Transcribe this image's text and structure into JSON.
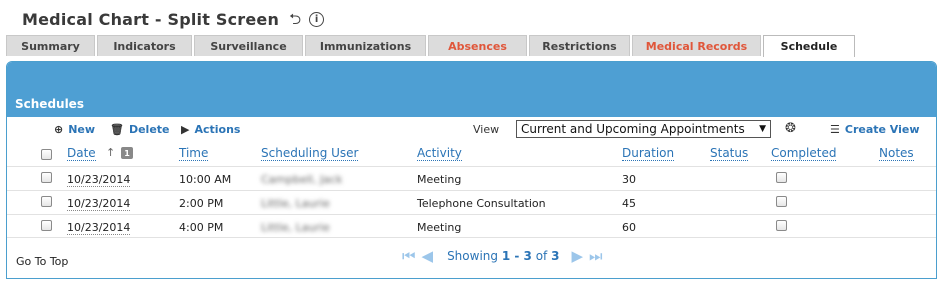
{
  "page": {
    "title": "Medical Chart - Split Screen",
    "title_icons": [
      "return-arrow-icon",
      "info-icon"
    ]
  },
  "tabs": [
    {
      "label": "Summary",
      "state": "normal"
    },
    {
      "label": "Indicators",
      "state": "normal"
    },
    {
      "label": "Surveillance",
      "state": "normal"
    },
    {
      "label": "Immunizations",
      "state": "normal"
    },
    {
      "label": "Absences",
      "state": "alert"
    },
    {
      "label": "Restrictions",
      "state": "normal"
    },
    {
      "label": "Medical Records",
      "state": "alert"
    },
    {
      "label": "Schedule",
      "state": "active"
    }
  ],
  "colors": {
    "header_blue": "#4e9fd3",
    "link_blue": "#2b74b6",
    "alert_red": "#e0563a"
  },
  "panel": {
    "title": "Schedules"
  },
  "toolbar": {
    "new_label": "New",
    "delete_label": "Delete",
    "actions_label": "Actions",
    "view_label": "View",
    "view_selected": "Current and Upcoming Appointments",
    "create_view_label": "Create View"
  },
  "columns": {
    "date": "Date",
    "sort_badge": "1",
    "time": "Time",
    "scheduling_user": "Scheduling User",
    "activity": "Activity",
    "duration": "Duration",
    "status": "Status",
    "completed": "Completed",
    "notes": "Notes"
  },
  "rows": [
    {
      "date": "10/23/2014",
      "time": "10:00 AM",
      "user": "Campbell, Jack",
      "activity": "Meeting",
      "duration": "30",
      "status": "",
      "completed": false,
      "notes": ""
    },
    {
      "date": "10/23/2014",
      "time": "2:00 PM",
      "user": "Little, Laurie",
      "activity": "Telephone Consultation",
      "duration": "45",
      "status": "",
      "completed": false,
      "notes": ""
    },
    {
      "date": "10/23/2014",
      "time": "4:00 PM",
      "user": "Little, Laurie",
      "activity": "Meeting",
      "duration": "60",
      "status": "",
      "completed": false,
      "notes": ""
    }
  ],
  "footer": {
    "go_top": "Go To Top",
    "showing_prefix": "Showing",
    "range": "1 - 3",
    "of": "of",
    "total": "3"
  }
}
